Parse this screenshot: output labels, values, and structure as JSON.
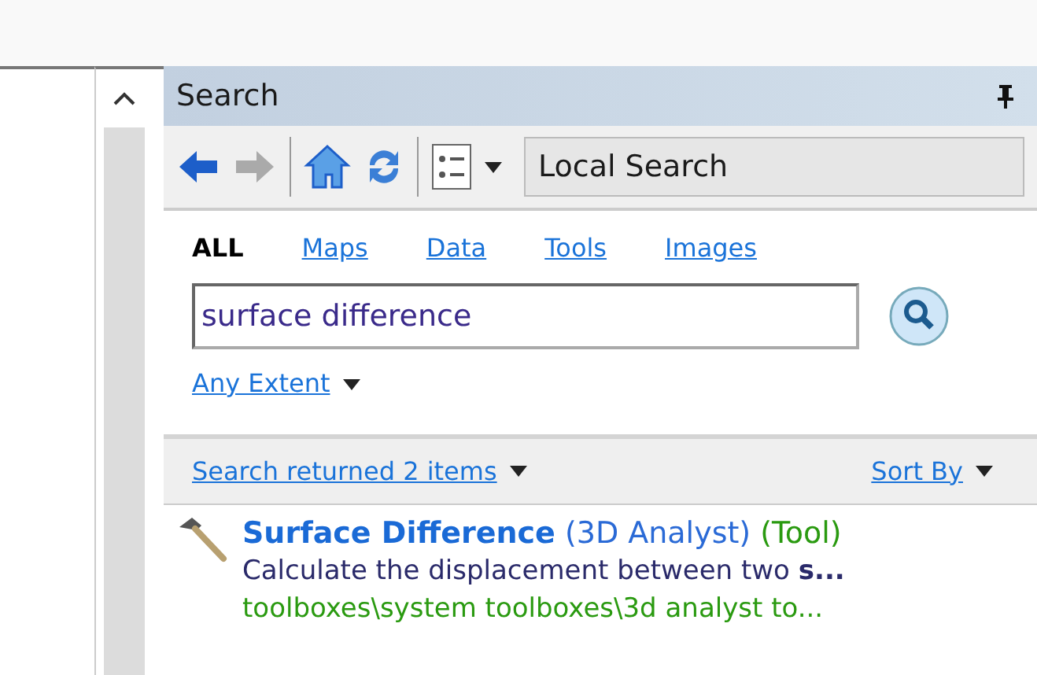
{
  "panel": {
    "title": "Search"
  },
  "toolbar": {
    "scope": "Local Search"
  },
  "tabs": [
    {
      "label": "ALL",
      "selected": true
    },
    {
      "label": "Maps",
      "selected": false
    },
    {
      "label": "Data",
      "selected": false
    },
    {
      "label": "Tools",
      "selected": false
    },
    {
      "label": "Images",
      "selected": false
    }
  ],
  "search": {
    "value": "surface difference"
  },
  "extent": "Any Extent",
  "results_header": {
    "summary": "Search returned 2 items",
    "sort": "Sort By"
  },
  "results": [
    {
      "name": "Surface Difference",
      "source": "(3D Analyst)",
      "type": "(Tool)",
      "description": "Calculate the displacement between two **s...**",
      "path": "toolboxes\\system toolboxes\\3d analyst to..."
    }
  ]
}
